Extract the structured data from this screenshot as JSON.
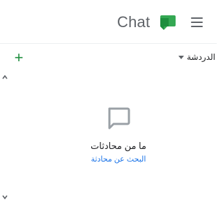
{
  "header": {
    "app_title": "Chat",
    "logo_icon": "google-chat-icon",
    "menu_icon": "hamburger-menu-icon",
    "colors": {
      "logo_dark": "#1e8e3e",
      "logo_light": "#34a853",
      "title": "#5f6368"
    }
  },
  "section": {
    "label": "الدردشة",
    "add_icon": "plus-icon",
    "toggle_icon": "caret-down-icon",
    "add_color": "#1e8e3e"
  },
  "empty_state": {
    "icon": "chat-bubble-icon",
    "title": "ما من محادثات",
    "link": "البحث عن محادثة",
    "link_color": "#1a73e8"
  },
  "scrollbar": {
    "up_icon": "scroll-up-arrow-icon",
    "down_icon": "scroll-down-arrow-icon"
  }
}
